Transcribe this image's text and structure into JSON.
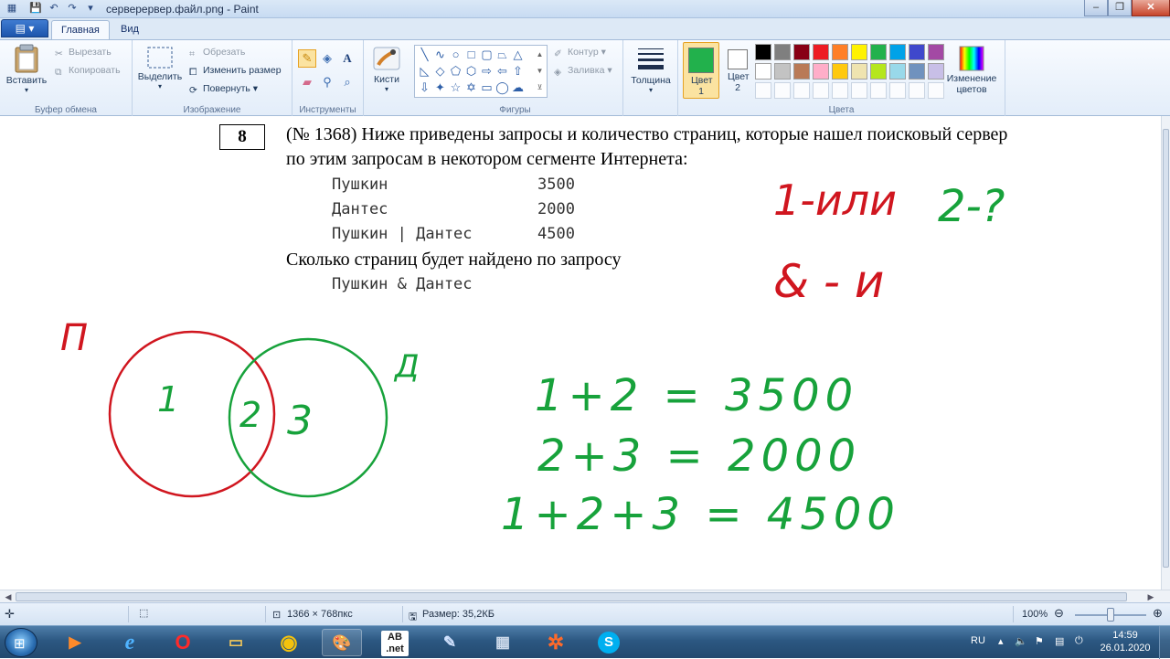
{
  "window": {
    "title": "серверервер.файл.png - Paint",
    "controls": {
      "minimize": "–",
      "maximize": "❐",
      "close": "✕"
    }
  },
  "quick_access": [
    "save-icon",
    "undo-icon",
    "redo-icon",
    "dropdown-icon"
  ],
  "menu": {
    "file_button": "▤ ▾",
    "tabs": [
      "Главная",
      "Вид"
    ]
  },
  "ribbon": {
    "clipboard": {
      "label": "Буфер обмена",
      "paste": "Вставить",
      "cut": "Вырезать",
      "copy": "Копировать"
    },
    "image": {
      "label": "Изображение",
      "select": "Выделить",
      "crop": "Обрезать",
      "resize": "Изменить размер",
      "rotate": "Повернуть"
    },
    "tools": {
      "label": "Инструменты"
    },
    "brushes": {
      "label": "Кисти"
    },
    "shapes": {
      "label": "Фигуры",
      "outline": "Контур",
      "fill": "Заливка"
    },
    "thickness": {
      "label": "Толщина"
    },
    "colors": {
      "label": "Цвета",
      "color1": "Цвет 1",
      "color2": "Цвет 2",
      "edit": "Изменение цветов",
      "color1_value": "#22b14c",
      "color2_value": "#ffffff",
      "palette_row1": [
        "#000000",
        "#7f7f7f",
        "#880015",
        "#ed1c24",
        "#ff7f27",
        "#fff200",
        "#22b14c",
        "#00a2e8",
        "#3f48cc",
        "#a349a4"
      ],
      "palette_row2": [
        "#ffffff",
        "#c3c3c3",
        "#b97a57",
        "#ffaec9",
        "#ffc90e",
        "#efe4b0",
        "#b5e61d",
        "#99d9ea",
        "#7092be",
        "#c8bfe7"
      ]
    }
  },
  "canvas": {
    "question_number": "8",
    "question_line1": "(№ 1368) Ниже приведены запросы и количество страниц, которые нашел поисковый сервер",
    "question_line2": "по этим запросам в некотором сегменте Интернета:",
    "queries": [
      {
        "query": "Пушкин",
        "count": "3500"
      },
      {
        "query": "Дантес",
        "count": "2000"
      },
      {
        "query": "Пушкин | Дантес",
        "count": "4500"
      }
    ],
    "question_line3": "Сколько страниц будет найдено по запросу",
    "final_query": "Пушкин & Дантес",
    "handwriting": {
      "or_note": "1-или",
      "two_q": "2-?",
      "and_note": "& - и",
      "label_p": "П",
      "label_d": "Д",
      "region1": "1",
      "region2": "2",
      "region3": "3",
      "eq1": "1+2 = 3500",
      "eq2": "2+3 = 2000",
      "eq3": "1+2+3 = 4500",
      "red": "#d0161f",
      "green": "#17a23b"
    }
  },
  "statusbar": {
    "dimensions": "1366 × 768пкс",
    "size": "Размер: 35,2КБ",
    "zoom": "100%"
  },
  "taskbar": {
    "lang": "RU",
    "time": "14:59",
    "date": "26.01.2020",
    "apps": [
      "media-player-icon",
      "ie-icon",
      "opera-icon",
      "explorer-icon",
      "chrome-icon",
      "paint-icon",
      "abc-net-icon",
      "notepad-icon",
      "calculator-icon",
      "game-icon",
      "skype-icon"
    ]
  }
}
